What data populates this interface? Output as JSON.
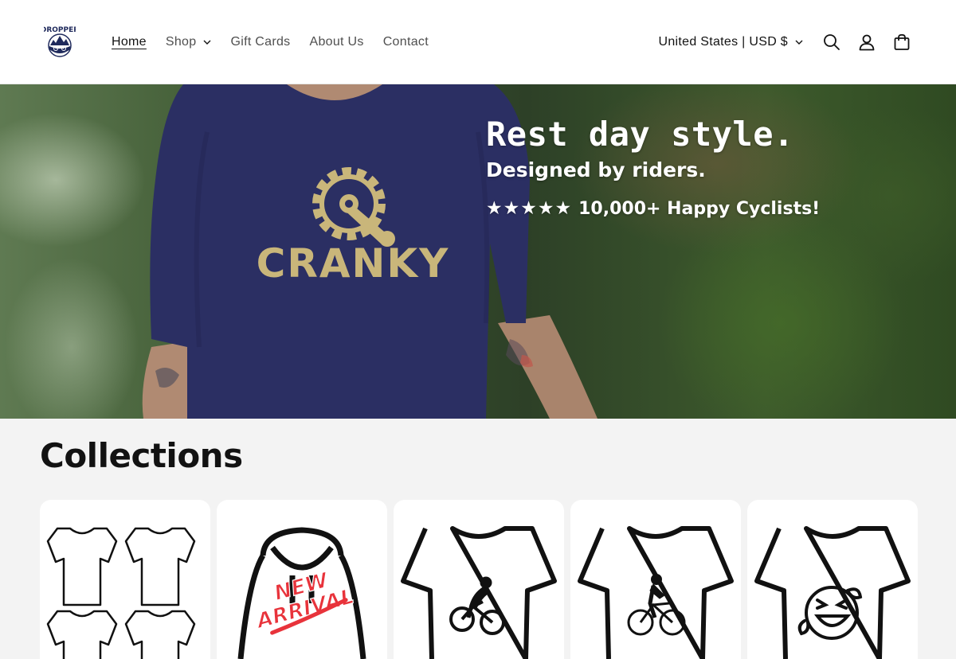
{
  "header": {
    "logo_text": "DROPPER",
    "nav": [
      {
        "label": "Home",
        "active": true
      },
      {
        "label": "Shop",
        "dropdown": true
      },
      {
        "label": "Gift Cards"
      },
      {
        "label": "About Us"
      },
      {
        "label": "Contact"
      }
    ],
    "country_selector": "United States | USD $",
    "icons": [
      "search-icon",
      "account-icon",
      "cart-icon"
    ]
  },
  "hero": {
    "title": "Rest day style.",
    "subtitle": "Designed by riders.",
    "rating_text": "10,000+ Happy Cyclists!",
    "stars": 5,
    "shirt_print": "CRANKY"
  },
  "collections": {
    "heading": "Collections",
    "cards": [
      {
        "icon": "tshirt-grid-icon"
      },
      {
        "icon": "new-arrival-hoodie-icon",
        "badge_lines": [
          "NEW",
          "ARRIVAL"
        ]
      },
      {
        "icon": "mtb-rider-tshirt-icon"
      },
      {
        "icon": "road-cyclist-tshirt-icon"
      },
      {
        "icon": "laughing-emoji-tshirt-icon"
      }
    ]
  },
  "colors": {
    "shirt": "#2b2f63",
    "print_gold": "#c9b67a",
    "badge_red": "#e8333b"
  }
}
